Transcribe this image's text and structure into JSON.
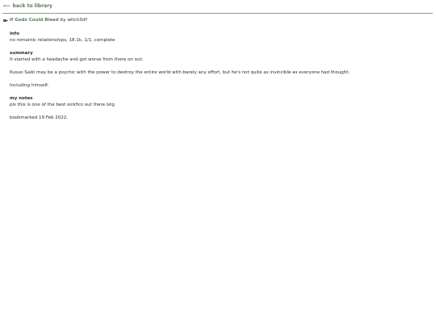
{
  "nav": {
    "back_arrow": "⟵",
    "back_label": "back to library"
  },
  "work": {
    "title": "If Gods Could Bleed",
    "by": "by",
    "author": "witch3dY"
  },
  "info": {
    "heading": "info",
    "text": "no romantic relationships, 18.1k, 1/1, complete"
  },
  "summary": {
    "heading": "summary",
    "paragraphs": [
      "It started with a headache and got worse from there on out.",
      "Kusuo Saiki may be a psychic with the power to destroy the entire world with barely any effort, but he's not quite as invincible as everyone had thought.",
      "Including himself."
    ]
  },
  "notes": {
    "heading": "my notes",
    "text": "pls this is one of the best sickfics out there istg"
  },
  "bookmarked": "bookmarked 19 Feb 2022."
}
